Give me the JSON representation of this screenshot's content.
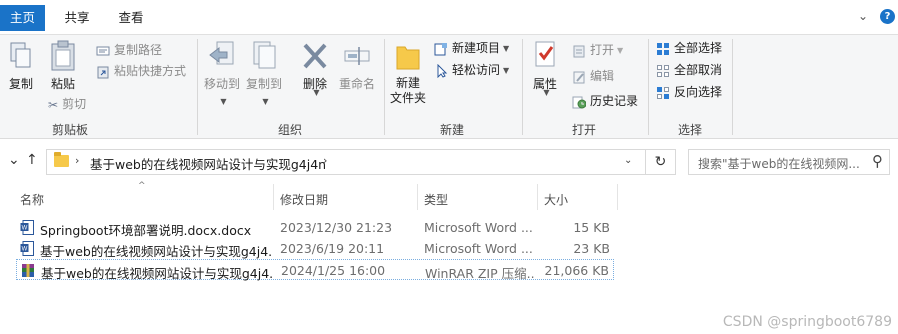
{
  "tabs": {
    "home": "主页",
    "share": "共享",
    "view": "查看"
  },
  "ribbon": {
    "clipboard": {
      "label": "剪贴板",
      "copy": "复制",
      "paste": "粘贴",
      "copy_path": "复制路径",
      "paste_shortcut": "粘贴快捷方式",
      "cut": "剪切"
    },
    "organize": {
      "label": "组织",
      "move_to": "移动到",
      "copy_to": "复制到",
      "delete": "删除",
      "rename": "重命名"
    },
    "new": {
      "label": "新建",
      "new_folder": "新建\n文件夹",
      "new_item": "新建项目",
      "easy_access": "轻松访问"
    },
    "open": {
      "label": "打开",
      "properties": "属性",
      "open": "打开",
      "edit": "编辑",
      "history": "历史记录"
    },
    "select": {
      "label": "选择",
      "select_all": "全部选择",
      "select_none": "全部取消",
      "invert": "反向选择"
    }
  },
  "address": {
    "path": "基于web的在线视频网站设计与实现g4j4n",
    "search_placeholder": "搜索\"基于web的在线视频网..."
  },
  "columns": {
    "name": "名称",
    "date": "修改日期",
    "type": "类型",
    "size": "大小"
  },
  "files": [
    {
      "name": "Springboot环境部署说明.docx.docx",
      "date": "2023/12/30 21:23",
      "type": "Microsoft Word ...",
      "size": "15 KB",
      "icon": "word-doc-icon"
    },
    {
      "name": "基于web的在线视频网站设计与实现g4j4...",
      "date": "2023/6/19 20:11",
      "type": "Microsoft Word ...",
      "size": "23 KB",
      "icon": "word-doc-icon"
    },
    {
      "name": "基于web的在线视频网站设计与实现g4j4...",
      "date": "2024/1/25 16:00",
      "type": "WinRAR ZIP 压缩...",
      "size": "21,066 KB",
      "icon": "winrar-zip-icon"
    }
  ],
  "watermark": "CSDN @springboot6789",
  "colors": {
    "accent": "#1a73c8",
    "folder": "#f6c94a",
    "word": "#2b579a",
    "delete": "#7a8aa0"
  }
}
